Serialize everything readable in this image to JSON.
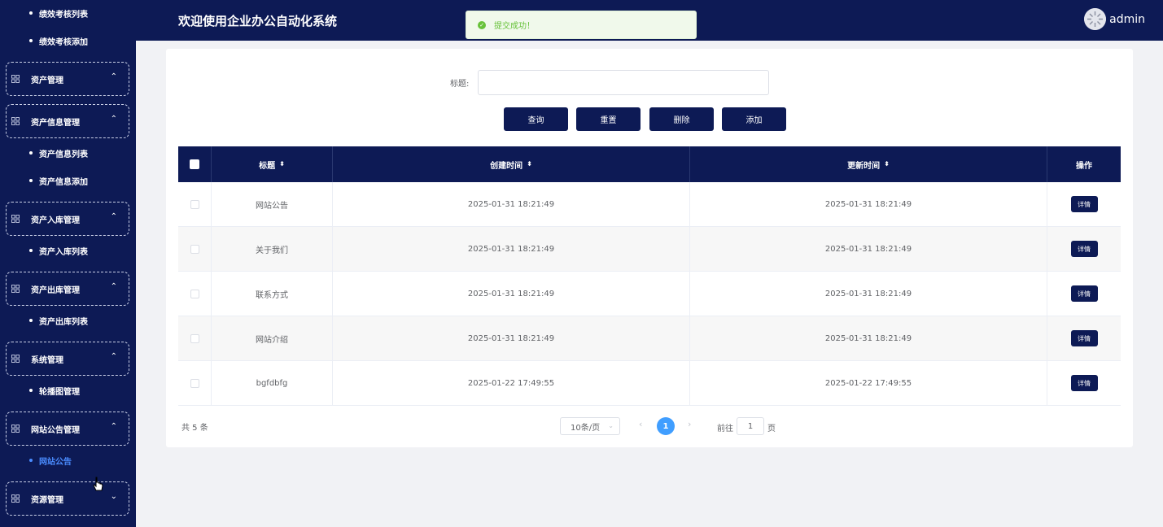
{
  "header": {
    "title": "欢迎使用企业办公自动化系统",
    "username": "admin"
  },
  "toast": {
    "message": "提交成功！"
  },
  "sidebar": {
    "entries": [
      {
        "type": "item",
        "label": "绩效考核列表"
      },
      {
        "type": "item",
        "label": "绩效考核添加"
      },
      {
        "type": "group",
        "label": "资产管理",
        "chevron": "up"
      },
      {
        "type": "group",
        "label": "资产信息管理",
        "chevron": "up"
      },
      {
        "type": "item",
        "label": "资产信息列表"
      },
      {
        "type": "item",
        "label": "资产信息添加"
      },
      {
        "type": "group",
        "label": "资产入库管理",
        "chevron": "up"
      },
      {
        "type": "item",
        "label": "资产入库列表"
      },
      {
        "type": "group",
        "label": "资产出库管理",
        "chevron": "up"
      },
      {
        "type": "item",
        "label": "资产出库列表"
      },
      {
        "type": "group",
        "label": "系统管理",
        "chevron": "up"
      },
      {
        "type": "item",
        "label": "轮播图管理"
      },
      {
        "type": "group",
        "label": "网站公告管理",
        "chevron": "up"
      },
      {
        "type": "item",
        "label": "网站公告",
        "active": true
      },
      {
        "type": "group",
        "label": "资源管理",
        "chevron": "down"
      }
    ]
  },
  "search": {
    "label": "标题:",
    "value": ""
  },
  "buttons": {
    "query": "查询",
    "reset": "重置",
    "delete": "删除",
    "add": "添加"
  },
  "table": {
    "columns": [
      "标题",
      "创建时间",
      "更新时间",
      "操作"
    ],
    "rows": [
      {
        "title": "网站公告",
        "created": "2025-01-31 18:21:49",
        "updated": "2025-01-31 18:21:49",
        "action": "详情"
      },
      {
        "title": "关于我们",
        "created": "2025-01-31 18:21:49",
        "updated": "2025-01-31 18:21:49",
        "action": "详情"
      },
      {
        "title": "联系方式",
        "created": "2025-01-31 18:21:49",
        "updated": "2025-01-31 18:21:49",
        "action": "详情"
      },
      {
        "title": "网站介绍",
        "created": "2025-01-31 18:21:49",
        "updated": "2025-01-31 18:21:49",
        "action": "详情"
      },
      {
        "title": "bgfdbfg",
        "created": "2025-01-22 17:49:55",
        "updated": "2025-01-22 17:49:55",
        "action": "详情"
      }
    ]
  },
  "pagination": {
    "total": "共 5 条",
    "page_size": "10条/页",
    "current_page": "1",
    "goto_label": "前往",
    "goto_value": "1",
    "goto_suffix": "页"
  },
  "colors": {
    "primary": "#0d1a55",
    "accent": "#409eff",
    "success": "#67c23a",
    "active_menu": "#4a8cff"
  },
  "icons": {
    "menu": "grid-icon",
    "success": "check-circle-icon",
    "sort": "sort-icon"
  }
}
